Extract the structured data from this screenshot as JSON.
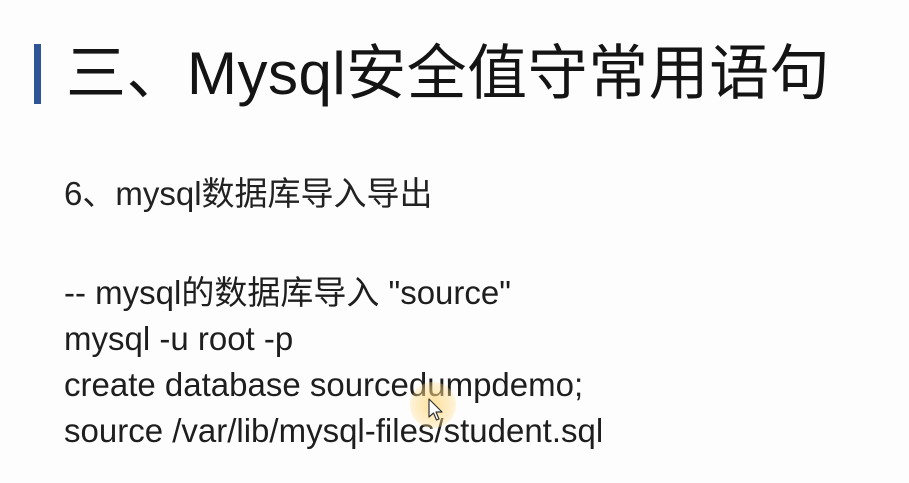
{
  "slide": {
    "title": "三、Mysql安全值守常用语句",
    "subtitle": "6、mysql数据库导入导出",
    "code_lines": [
      "-- mysql的数据库导入 \"source\"",
      "mysql -u root -p",
      "create database sourcedumpdemo;",
      "source /var/lib/mysql-files/student.sql"
    ]
  },
  "colors": {
    "accent_bar": "#2f5597",
    "cursor_highlight": "#ffd678"
  },
  "icons": {
    "cursor": "mouse-pointer-icon"
  }
}
